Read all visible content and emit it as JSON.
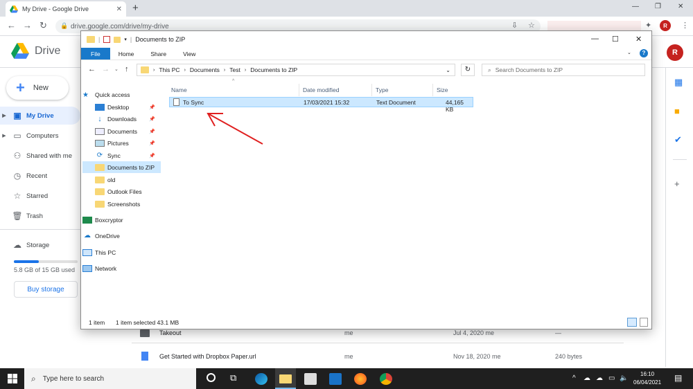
{
  "browser": {
    "tab_title": "My Drive - Google Drive",
    "url": "drive.google.com/drive/my-drive",
    "profile_initial": "R"
  },
  "drive": {
    "app_name": "Drive",
    "new_label": "New",
    "nav": [
      {
        "label": "My Drive",
        "icon": "my-drive-icon"
      },
      {
        "label": "Computers",
        "icon": "computer-icon"
      },
      {
        "label": "Shared with me",
        "icon": "shared-icon"
      },
      {
        "label": "Recent",
        "icon": "clock-icon"
      },
      {
        "label": "Starred",
        "icon": "star-icon"
      },
      {
        "label": "Trash",
        "icon": "trash-icon"
      },
      {
        "label": "Storage",
        "icon": "cloud-icon"
      }
    ],
    "storage_text": "5.8 GB of 15 GB used",
    "storage_fraction": 0.39,
    "buy_storage": "Buy storage",
    "rows": [
      {
        "name": "Takeout",
        "owner": "me",
        "modified": "Jul 4, 2020 me",
        "size": "—"
      },
      {
        "name": "Get Started with Dropbox Paper.url",
        "owner": "me",
        "modified": "Nov 18, 2020 me",
        "size": "240 bytes"
      }
    ]
  },
  "explorer": {
    "title": "Documents to ZIP",
    "ribbon": [
      "File",
      "Home",
      "Share",
      "View"
    ],
    "breadcrumb": [
      "This PC",
      "Documents",
      "Test",
      "Documents to ZIP"
    ],
    "search_placeholder": "Search Documents to ZIP",
    "tree": [
      {
        "label": "Quick access",
        "pin": false
      },
      {
        "label": "Desktop",
        "pin": true
      },
      {
        "label": "Downloads",
        "pin": true
      },
      {
        "label": "Documents",
        "pin": true
      },
      {
        "label": "Pictures",
        "pin": true
      },
      {
        "label": "Sync",
        "pin": true
      },
      {
        "label": "Documents to ZIP",
        "pin": false
      },
      {
        "label": "old",
        "pin": false
      },
      {
        "label": "Outlook Files",
        "pin": false
      },
      {
        "label": "Screenshots",
        "pin": false
      },
      {
        "label": "Boxcryptor",
        "pin": false
      },
      {
        "label": "OneDrive",
        "pin": false
      },
      {
        "label": "This PC",
        "pin": false
      },
      {
        "label": "Network",
        "pin": false
      }
    ],
    "columns": [
      "Name",
      "Date modified",
      "Type",
      "Size"
    ],
    "files": [
      {
        "name": "To Sync",
        "modified": "17/03/2021 15:32",
        "type": "Text Document",
        "size": "44,165 KB"
      }
    ],
    "status_count": "1 item",
    "status_selected": "1 item selected  43.1 MB"
  },
  "taskbar": {
    "search_placeholder": "Type here to search",
    "time": "16:10",
    "date": "06/04/2021"
  }
}
